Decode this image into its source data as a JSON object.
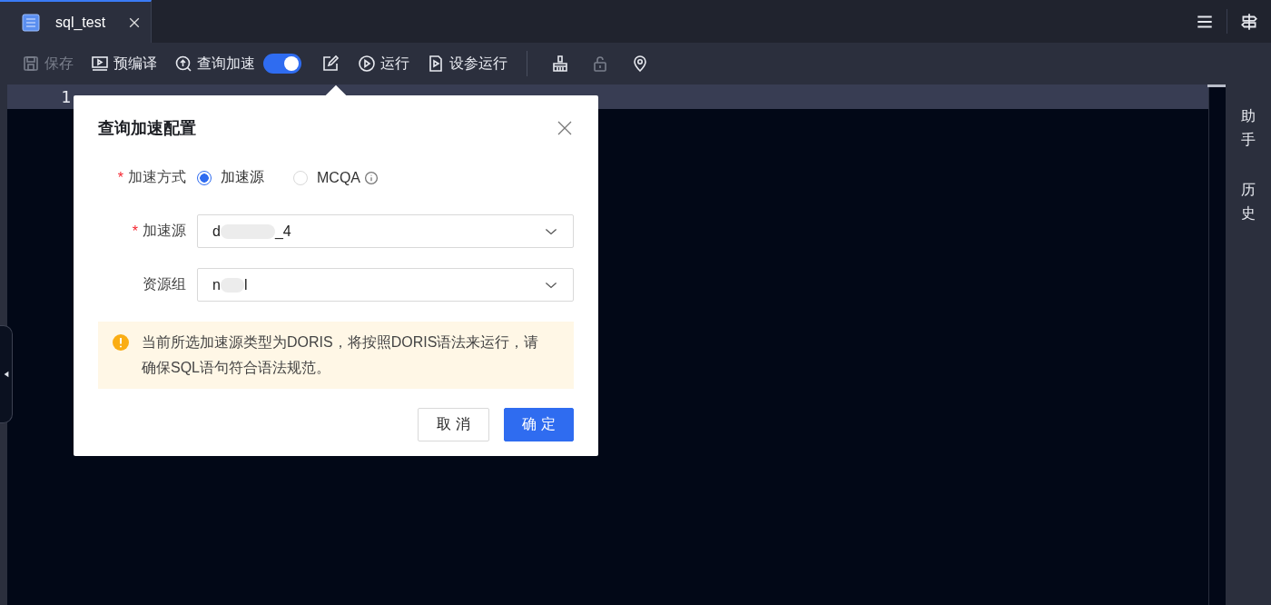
{
  "tabs": [
    {
      "label": "sql_test",
      "selected": true
    }
  ],
  "toolbar": [
    {
      "kind": "button",
      "label": "保存",
      "disabled": true
    },
    {
      "kind": "button",
      "label": "预编译",
      "disabled": false
    },
    {
      "kind": "button",
      "label": "查询加速",
      "disabled": false
    },
    {
      "kind": "toggle",
      "on": true
    },
    {
      "kind": "icon",
      "disabled": false
    },
    {
      "kind": "button",
      "label": "运行",
      "disabled": false
    },
    {
      "kind": "button",
      "label": "设参运行",
      "disabled": false
    },
    {
      "kind": "divider"
    },
    {
      "kind": "icon",
      "disabled": false
    },
    {
      "kind": "icon",
      "disabled": true
    },
    {
      "kind": "icon",
      "disabled": false
    }
  ],
  "editor": {
    "lines": [
      {
        "number": "1"
      }
    ]
  },
  "side_panel": [
    "助手",
    "历史"
  ],
  "dialog": {
    "title": "查询加速配置",
    "fields": [
      {
        "kind": "radio",
        "label": "加速方式",
        "required": "*",
        "options": [
          {
            "label": "加速源",
            "selected": true,
            "info": false
          },
          {
            "label": "MCQA",
            "selected": false,
            "info": true
          }
        ]
      },
      {
        "kind": "select",
        "label": "加速源",
        "required": "*",
        "value_start": "d",
        "value_end": "_4",
        "redacted": true
      },
      {
        "kind": "select",
        "label": "资源组",
        "value_start": "n",
        "value_end": "l",
        "redacted": true
      }
    ],
    "warning": "当前所选加速源类型为DORIS，将按照DORIS语法来运行，请确保SQL语句符合语法规范。",
    "buttons": [
      {
        "label": "取 消",
        "primary": false
      },
      {
        "label": "确 定",
        "primary": true
      }
    ]
  }
}
